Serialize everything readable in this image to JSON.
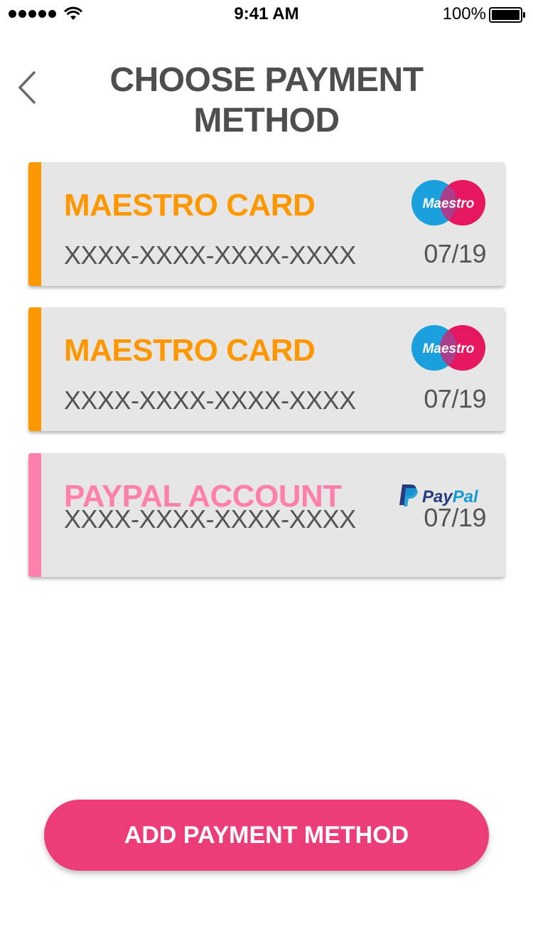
{
  "status_bar": {
    "time": "9:41 AM",
    "battery": "100%",
    "icons": [
      "signal-dots-icon",
      "wifi-icon",
      "battery-icon"
    ]
  },
  "header": {
    "title": "CHOOSE PAYMENT METHOD",
    "back_icon": "chevron-left-icon"
  },
  "cards": [
    {
      "title": "MAESTRO CARD",
      "number": "XXXX-XXXX-XXXX-XXXX",
      "expiry": "07/19",
      "logo": "Maestro",
      "accent": "#ff9800"
    },
    {
      "title": "MAESTRO CARD",
      "number": "XXXX-XXXX-XXXX-XXXX",
      "expiry": "07/19",
      "logo": "Maestro",
      "accent": "#ff9800"
    },
    {
      "title": "PAYPAL ACCOUNT",
      "number": "XXXX-XXXX-XXXX-XXXX",
      "expiry": "07/19",
      "logo": "PayPal",
      "accent": "#ff80ab"
    }
  ],
  "add_button": {
    "label": "ADD PAYMENT METHOD",
    "color": "#ec3d78"
  }
}
